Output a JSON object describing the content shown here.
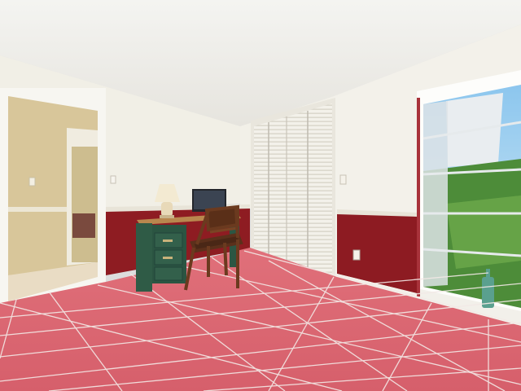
{
  "scene": {
    "description_free": true,
    "colors": {
      "ceiling": "#ecebe6",
      "wall": "#f1efe7",
      "wainscot": "#8f1d22",
      "chair_rail": "#e8e4d8",
      "floor_tile": "#d96a73",
      "grout": "#efe6e2",
      "desk": "#2f5b46",
      "desk_top": "#b9874e",
      "closet": "#f2f0ea",
      "hall_wall": "#d8c79b",
      "window_frame": "#ffffff",
      "foliage": "#4f8e3a",
      "sky": "#9fd0ef",
      "bottle": "#5aa08f"
    },
    "objects": [
      {
        "name": "doorway-to-hallway"
      },
      {
        "name": "table-lamp"
      },
      {
        "name": "computer-monitor"
      },
      {
        "name": "desk"
      },
      {
        "name": "wooden-chair"
      },
      {
        "name": "bifold-closet-doors"
      },
      {
        "name": "window"
      },
      {
        "name": "glass-bottle"
      },
      {
        "name": "tiled-floor"
      }
    ]
  }
}
